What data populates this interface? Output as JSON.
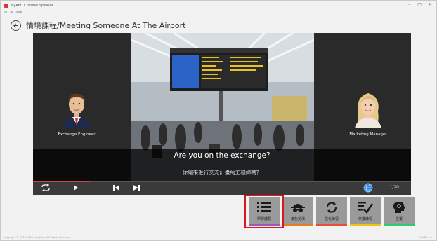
{
  "window": {
    "title": "MyABC Chinese Speaker",
    "toolbar": [
      "⊖",
      "⊕",
      "idle"
    ]
  },
  "header": {
    "title": "情境課程/Meeting Someone At The Airport"
  },
  "stage": {
    "left_character": {
      "label": "Exchange Engineer"
    },
    "right_character": {
      "label": "Marketing Manager"
    },
    "subtitle_en": "Are you on the exchange?",
    "subtitle_zh": "你是來進行交流計畫的工程師嗎？",
    "progress": 0.15
  },
  "controls": {
    "page_count": "1/20",
    "icons": [
      "repeat-icon",
      "play-icon",
      "previous-icon",
      "next-icon",
      "globe-icon"
    ]
  },
  "mode_buttons": [
    {
      "label": "學習課程",
      "icon": "list-icon",
      "bar_color": "#9b59b6",
      "selected": true
    },
    {
      "label": "角色扮演",
      "icon": "spy-icon",
      "bar_color": "#e67e22",
      "selected": false
    },
    {
      "label": "強化練習",
      "icon": "cycle-icon",
      "bar_color": "#e74c3c",
      "selected": false
    },
    {
      "label": "作業練習",
      "icon": "checklist-icon",
      "bar_color": "#f1c40f",
      "selected": false
    },
    {
      "label": "設置",
      "icon": "settings-head-icon",
      "bar_color": "#2ecc71",
      "selected": false
    }
  ],
  "footer": {
    "left": "Copyright © 2009-2016 Lucky Inc. All Rights Reserved",
    "right": "MyABC 4.2"
  }
}
